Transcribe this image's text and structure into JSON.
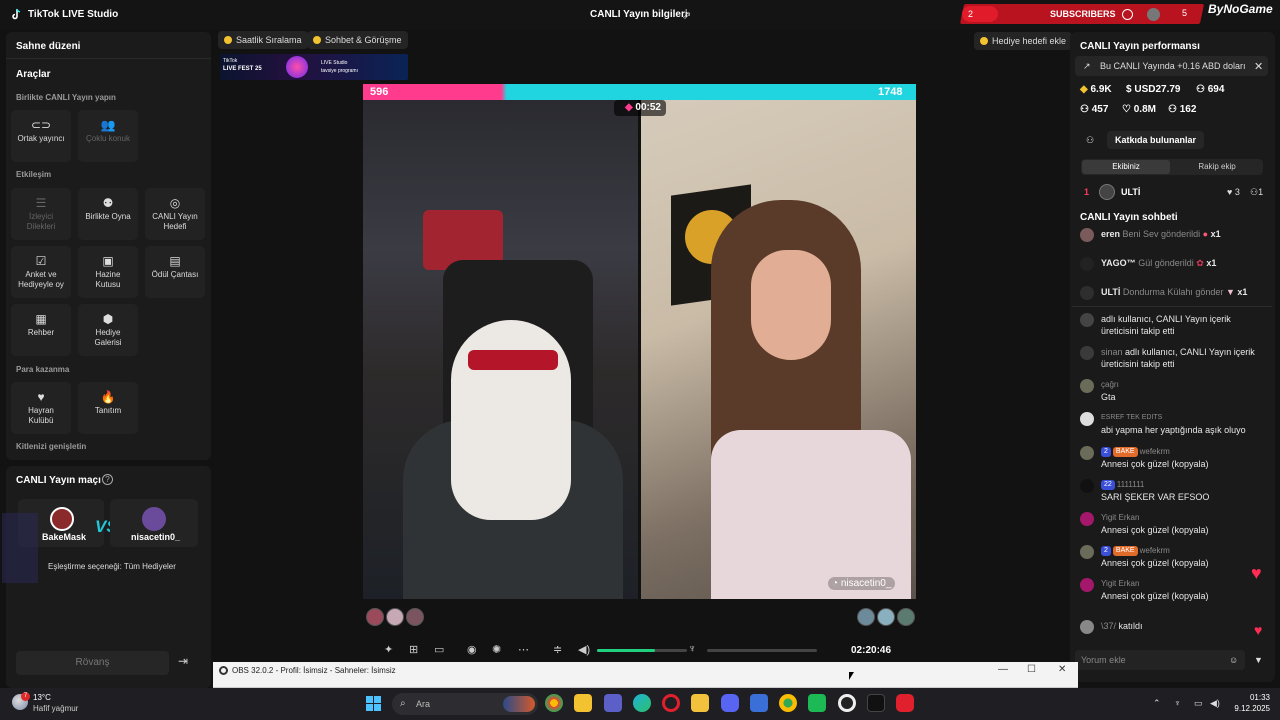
{
  "titlebar": {
    "app_name": "TikTok LIVE Studio",
    "center_title": "CANLI Yayın bilgileri"
  },
  "overlay": {
    "subs_left": "2",
    "subs_label": "SUBSCRIBERS",
    "subs_right": "5",
    "brand": "ByNoGame"
  },
  "left": {
    "scene_title": "Sahne düzeni",
    "tools_title": "Araçlar",
    "group_together": "Birlikte CANLI Yayın yapın",
    "tool_cohost": "Ortak yayıncı",
    "tool_multiguest": "Çoklu konuk",
    "group_interaction": "Etkileşim",
    "tool_viewer_requests_1": "İzleyici",
    "tool_viewer_requests_2": "Dilekleri",
    "tool_play_together": "Birlikte Oyna",
    "tool_live_goal_1": "CANLI Yayın",
    "tool_live_goal_2": "Hedefi",
    "tool_poll_1": "Anket ve",
    "tool_poll_2": "Hediyeyle oy",
    "tool_treasure_1": "Hazine",
    "tool_treasure_2": "Kutusu",
    "tool_reward_bag": "Ödül Çantası",
    "tool_guide": "Rehber",
    "tool_gift_gallery_1": "Hediye",
    "tool_gift_gallery_2": "Galerisi",
    "group_monetization": "Para kazanma",
    "tool_fan_club_1": "Hayran",
    "tool_fan_club_2": "Kulübü",
    "tool_promote": "Tanıtım",
    "group_expand": "Kitlenizi genişletin",
    "match_title": "CANLI Yayın maçı",
    "player_left": "BakeMask",
    "vs": "VS",
    "player_right": "nisacetin0_",
    "match_option": "Eşleştirme seçeneği: Tüm Hediyeler",
    "rematch": "Rövanş"
  },
  "top_pills": {
    "hourly_ranking": "Saatlik Sıralama",
    "chat_meeting": "Sohbet & Görüşme",
    "gift_goal": "Hediye hedefi ekle"
  },
  "banner": {
    "line1": "TikTok",
    "line2": "LIVE FEST 25",
    "line3": "LIVE Studio",
    "line4": "tavsiye programı"
  },
  "battle": {
    "score_left": "596",
    "score_right": "1748",
    "timer": "00:52",
    "right_tag": "nisacetin0_"
  },
  "controls": {
    "elapsed": "02:20:46",
    "volume_level": 0.64
  },
  "right": {
    "perf_title": "CANLI Yayın performansı",
    "earning_note": "Bu CANLI Yayında +0.16 ABD doları",
    "stat_diamonds": "6.9K",
    "stat_usd": "USD27.79",
    "stat_viewers": "694",
    "stat_viewers2": "457",
    "stat_likes": "0.8M",
    "stat_shares": "162",
    "contributors": "Katkıda bulunanlar",
    "tab_your_team": "Ekibiniz",
    "tab_opponent": "Rakip ekip",
    "rank_no": "1",
    "rank_name": "ULTİ",
    "rank_stat1": "3",
    "rank_stat2": "1",
    "chat_title": "CANLI Yayın sohbeti",
    "gift1_user": "eren",
    "gift1_text": "Beni Sev gönderildi",
    "gift1_count": "x1",
    "gift2_user": "YAGO™",
    "gift2_text": "Gül gönderildi",
    "gift2_count": "x1",
    "gift3_user": "ULTİ",
    "gift3_text": "Dondurma Külahı gönder",
    "gift3_count": "x1",
    "msg1": "adlı kullanıcı, CANLI Yayın içerik üreticisini takip etti",
    "msg2_user": "sinan",
    "msg2": "adlı kullanıcı, CANLI Yayın içerik üreticisini takip etti",
    "msg3_user": "çağrı",
    "msg3": "Gta",
    "msg4_user": "ESREF TEK EDITS",
    "msg4": "abi yapma her yaptığında aşık oluyo",
    "msg5_badge1": "2",
    "msg5_badge2": "BAKE",
    "msg5_user": "wefekrm",
    "msg5": "Annesi çok güzel (kopyala)",
    "msg6_badge1": "22",
    "msg6_user": "1111111",
    "msg6": "SARI ŞEKER VAR EFSOO",
    "msg7_user": "Yigit Erkan",
    "msg7": "Annesi çok güzel (kopyala)",
    "msg8_badge1": "2",
    "msg8_badge2": "BAKE",
    "msg8_user": "wefekrm",
    "msg8": "Annesi çok güzel (kopyala)",
    "msg9_user": "Yigit Erkan",
    "msg9": "Annesi çok güzel (kopyala)",
    "msg10_user": "\\37/",
    "msg10": "katıldı",
    "comment_placeholder": "Yorum ekle"
  },
  "obs": {
    "title": "OBS 32.0.2 - Profil: İsimsiz - Sahneler: İsimsiz"
  },
  "taskbar": {
    "temp": "13°C",
    "weather": "Hafif yağmur",
    "search": "Ara",
    "time": "01:33",
    "date": "9.12.2025",
    "weather_badge": "7"
  },
  "colors": {
    "accent_pink": "#ff3b8e",
    "accent_cyan": "#20d5e0",
    "green": "#21d07f"
  }
}
